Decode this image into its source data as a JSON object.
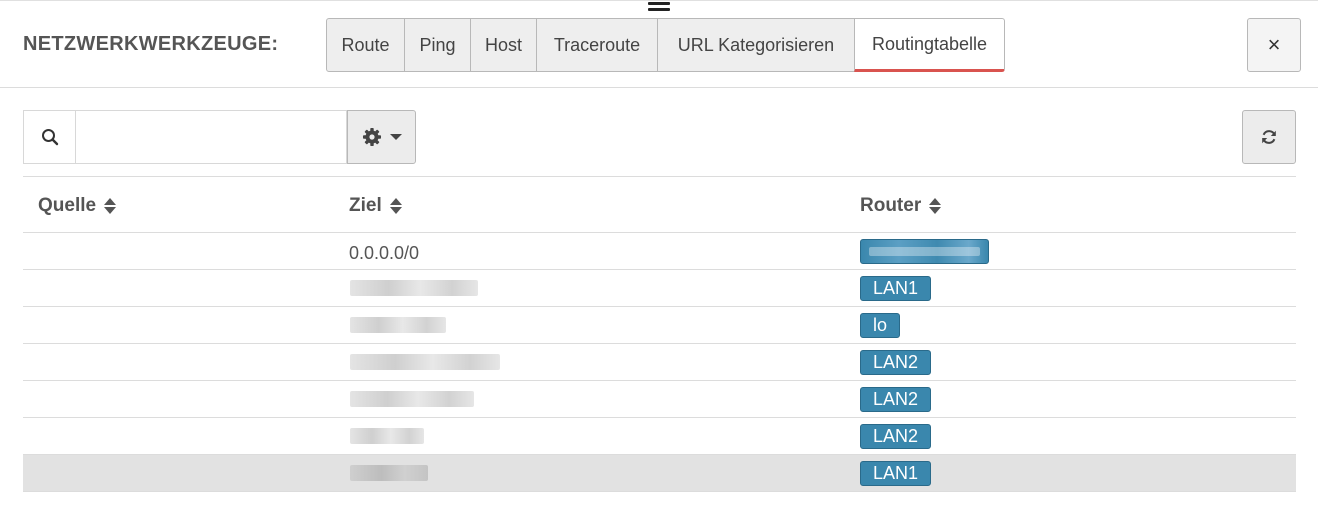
{
  "header": {
    "title": "NETZWERKWERKZEUGE:",
    "tabs": [
      {
        "label": "Route"
      },
      {
        "label": "Ping"
      },
      {
        "label": "Host"
      },
      {
        "label": "Traceroute"
      },
      {
        "label": "URL Kategorisieren"
      },
      {
        "label": "Routingtabelle"
      }
    ],
    "active_tab": "Routingtabelle",
    "close_label": "×"
  },
  "toolbar": {
    "search_value": "",
    "search_icon": "search-icon",
    "settings_icon": "gear-icon",
    "refresh_icon": "refresh-icon"
  },
  "table": {
    "columns": [
      {
        "label": "Quelle"
      },
      {
        "label": "Ziel"
      },
      {
        "label": "Router"
      }
    ],
    "rows": [
      {
        "quelle": "",
        "ziel": "0.0.0.0/0",
        "router": ""
      },
      {
        "quelle": "",
        "ziel": "",
        "router": "LAN1"
      },
      {
        "quelle": "",
        "ziel": "",
        "router": "lo"
      },
      {
        "quelle": "",
        "ziel": "",
        "router": "LAN2"
      },
      {
        "quelle": "",
        "ziel": "",
        "router": "LAN2"
      },
      {
        "quelle": "",
        "ziel": "",
        "router": "LAN2"
      },
      {
        "quelle": "",
        "ziel": "",
        "router": "LAN1"
      }
    ]
  },
  "colors": {
    "badge": "#3a87ad",
    "active_tab_underline": "#d9534f",
    "selected_row": "#e2e2e2"
  }
}
